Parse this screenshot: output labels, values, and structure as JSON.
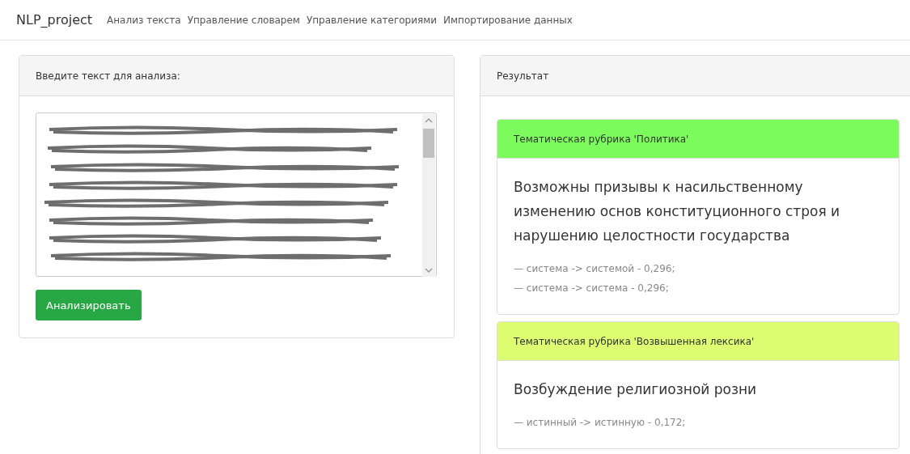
{
  "navbar": {
    "brand": "NLP_project",
    "links": [
      "Анализ текста",
      "Управление словарем",
      "Управление категориями",
      "Импортирование данных"
    ]
  },
  "input_panel": {
    "title": "Введите текст для анализа:",
    "button": "Анализировать"
  },
  "result_panel": {
    "title": "Результат",
    "cards": [
      {
        "header": "Тематическая рубрика 'Политика'",
        "color": "#7cfc5c",
        "statement": "Возможны призывы к насильственному изменению основ конституционного строя и нарушению целостности государства",
        "matches": [
          "— система -> системой - 0,296;",
          "— система -> система - 0,296;"
        ]
      },
      {
        "header": "Тематическая рубрика 'Возвышенная лексика'",
        "color": "#dcfd72",
        "statement": "Возбуждение религиозной розни",
        "matches": [
          "— истинный -> истинную - 0,172;"
        ]
      }
    ]
  }
}
